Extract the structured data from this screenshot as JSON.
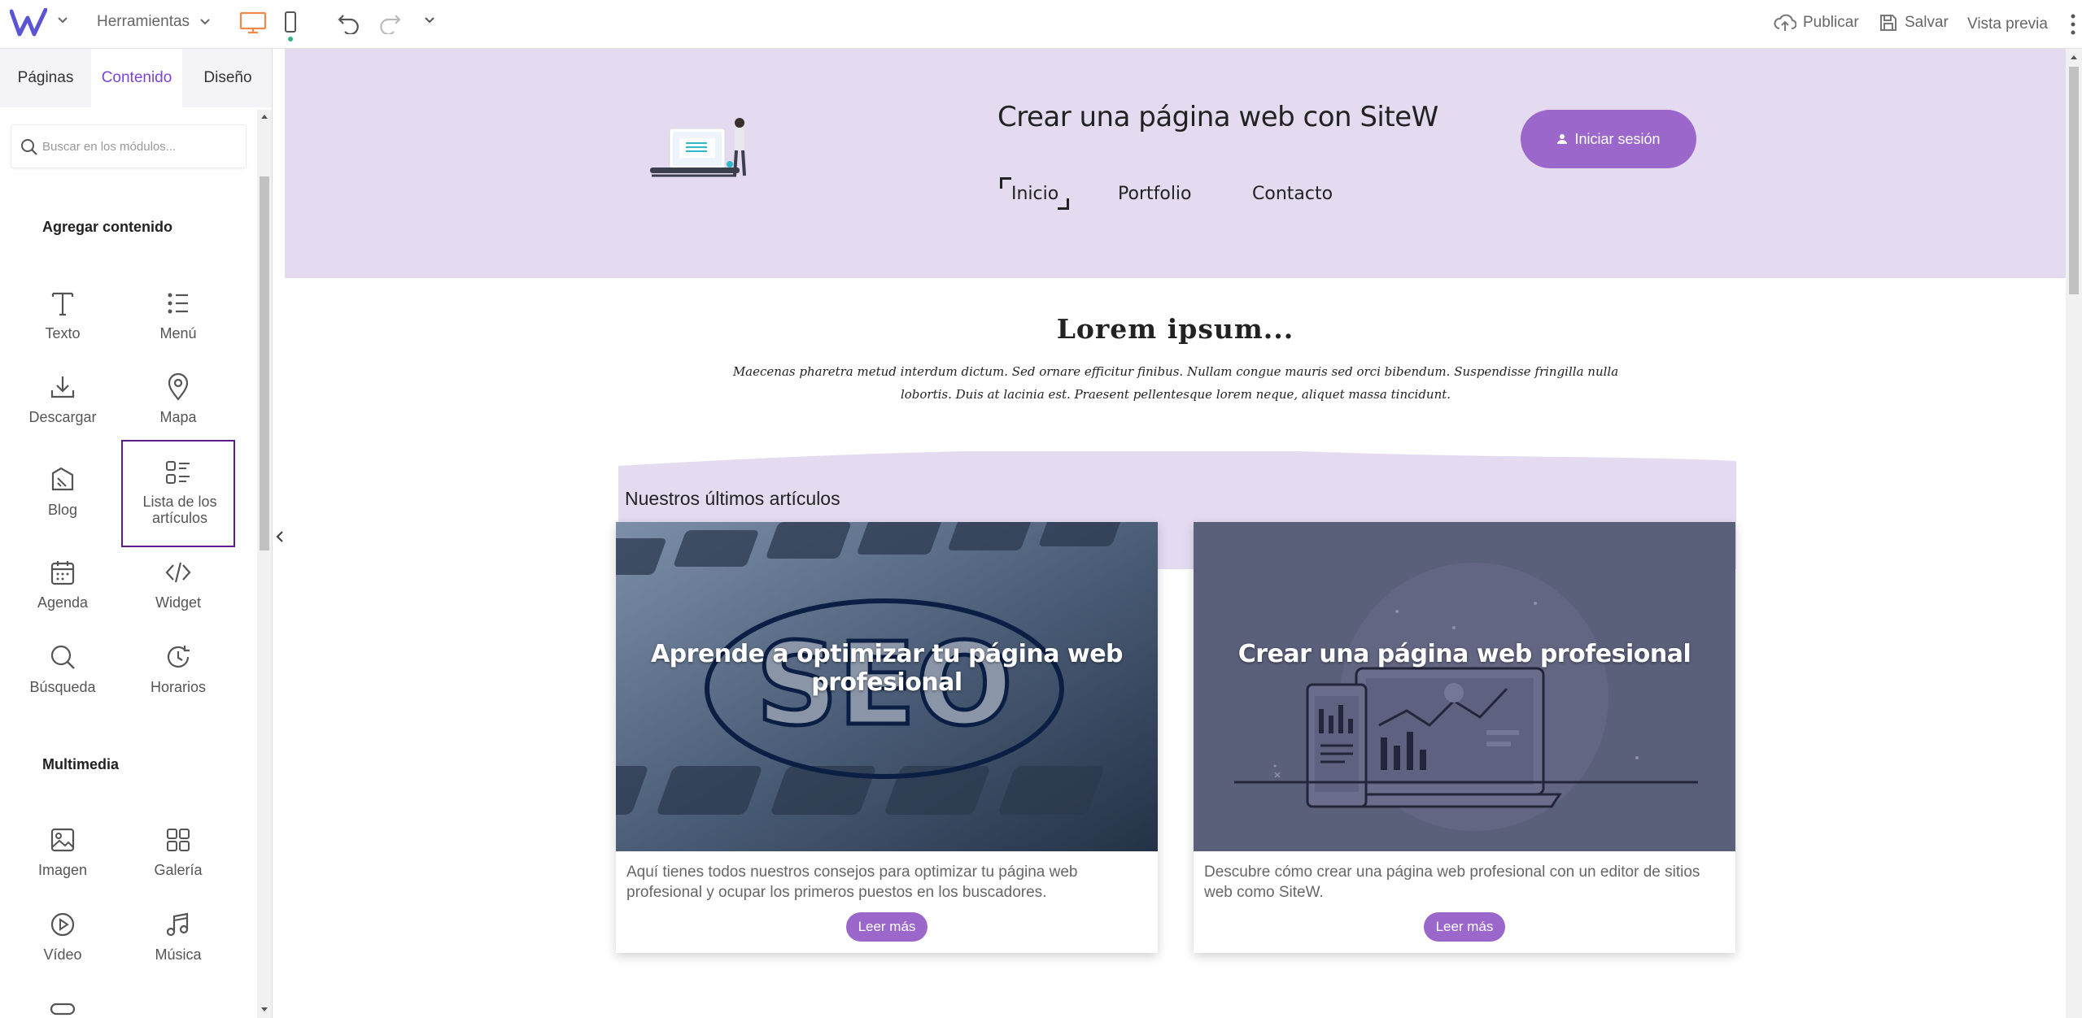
{
  "topbar": {
    "logo": "W",
    "tools_label": "Herramientas",
    "publish_label": "Publicar",
    "save_label": "Salvar",
    "preview_label": "Vista previa"
  },
  "sidebar": {
    "tabs": [
      {
        "label": "Páginas"
      },
      {
        "label": "Contenido",
        "active": true
      },
      {
        "label": "Diseño"
      }
    ],
    "search_placeholder": "Buscar en los módulos...",
    "add_content_title": "Agregar contenido",
    "modules": [
      {
        "label": "Texto",
        "icon": "text-icon"
      },
      {
        "label": "Menú",
        "icon": "menu-list-icon"
      },
      {
        "label": "Descargar",
        "icon": "download-icon"
      },
      {
        "label": "Mapa",
        "icon": "map-pin-icon"
      },
      {
        "label": "Blog",
        "icon": "blog-icon"
      },
      {
        "label": "Lista de los artículos",
        "icon": "article-list-icon",
        "selected": true
      },
      {
        "label": "Agenda",
        "icon": "calendar-icon"
      },
      {
        "label": "Widget",
        "icon": "code-icon"
      },
      {
        "label": "Búsqueda",
        "icon": "search-icon"
      },
      {
        "label": "Horarios",
        "icon": "clock-icon"
      }
    ],
    "multimedia_title": "Multimedia",
    "media_modules": [
      {
        "label": "Imagen",
        "icon": "image-icon"
      },
      {
        "label": "Galería",
        "icon": "gallery-icon"
      },
      {
        "label": "Vídeo",
        "icon": "play-icon"
      },
      {
        "label": "Música",
        "icon": "music-icon"
      }
    ]
  },
  "site": {
    "title": "Crear una página web con SiteW",
    "login_label": "Iniciar sesión",
    "nav": [
      "Inicio",
      "Portfolio",
      "Contacto"
    ],
    "lorem_title": "Lorem ipsum...",
    "lorem_text": "Maecenas pharetra metud interdum dictum. Sed ornare efficitur finibus. Nullam congue mauris sed orci bibendum. Suspendisse fringilla nulla lobortis. Duis at lacinia est. Praesent pellentesque lorem neque, aliquet massa tincidunt.",
    "articles_title": "Nuestros últimos artículos",
    "articles": [
      {
        "title": "Aprende a optimizar tu página web profesional",
        "image_text": "SEO",
        "description": "Aquí tienes todos nuestros consejos para optimizar tu página web profesional y ocupar los primeros puestos en los buscadores.",
        "button": "Leer más"
      },
      {
        "title": "Crear una página web profesional",
        "description": "Descubre cómo crear una página web profesional con un editor de sitios web como SiteW.",
        "button": "Leer más"
      }
    ]
  },
  "colors": {
    "accent": "#7b45d1",
    "header_bg": "#e4dbf0",
    "button": "#9c67cb",
    "desktop_icon": "#f08a4b"
  }
}
